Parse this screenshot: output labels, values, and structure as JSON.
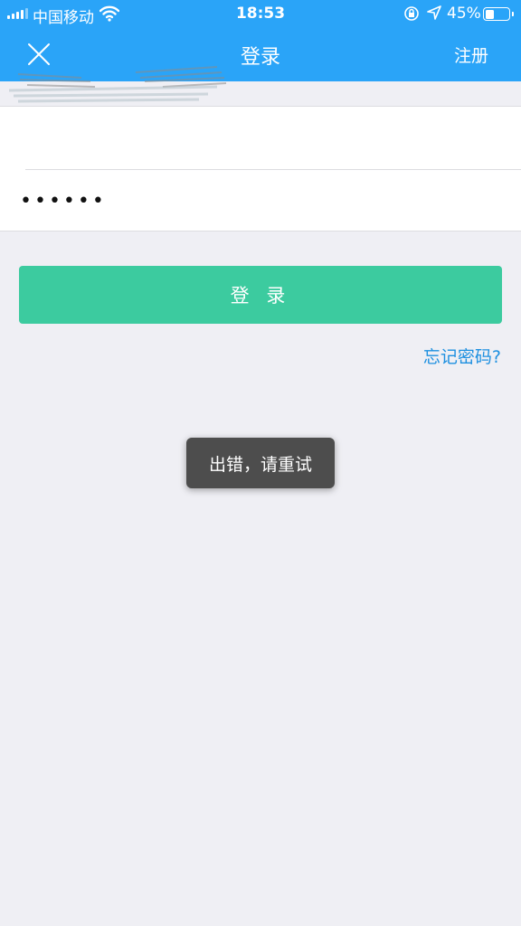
{
  "status_bar": {
    "carrier": "中国移动",
    "time": "18:53",
    "battery_percent": "45%",
    "battery_level": 0.45,
    "signal_bars": 4
  },
  "nav": {
    "title": "登录",
    "register": "注册",
    "close_icon": "close-icon"
  },
  "form": {
    "username_value": "",
    "password_value": "••••••"
  },
  "login_button": "登 录",
  "forgot_link": "忘记密码?",
  "toast": "出错，请重试",
  "colors": {
    "nav_blue": "#2aa4f8",
    "button_green": "#3ccb9f",
    "link_blue": "#1e90e0"
  }
}
